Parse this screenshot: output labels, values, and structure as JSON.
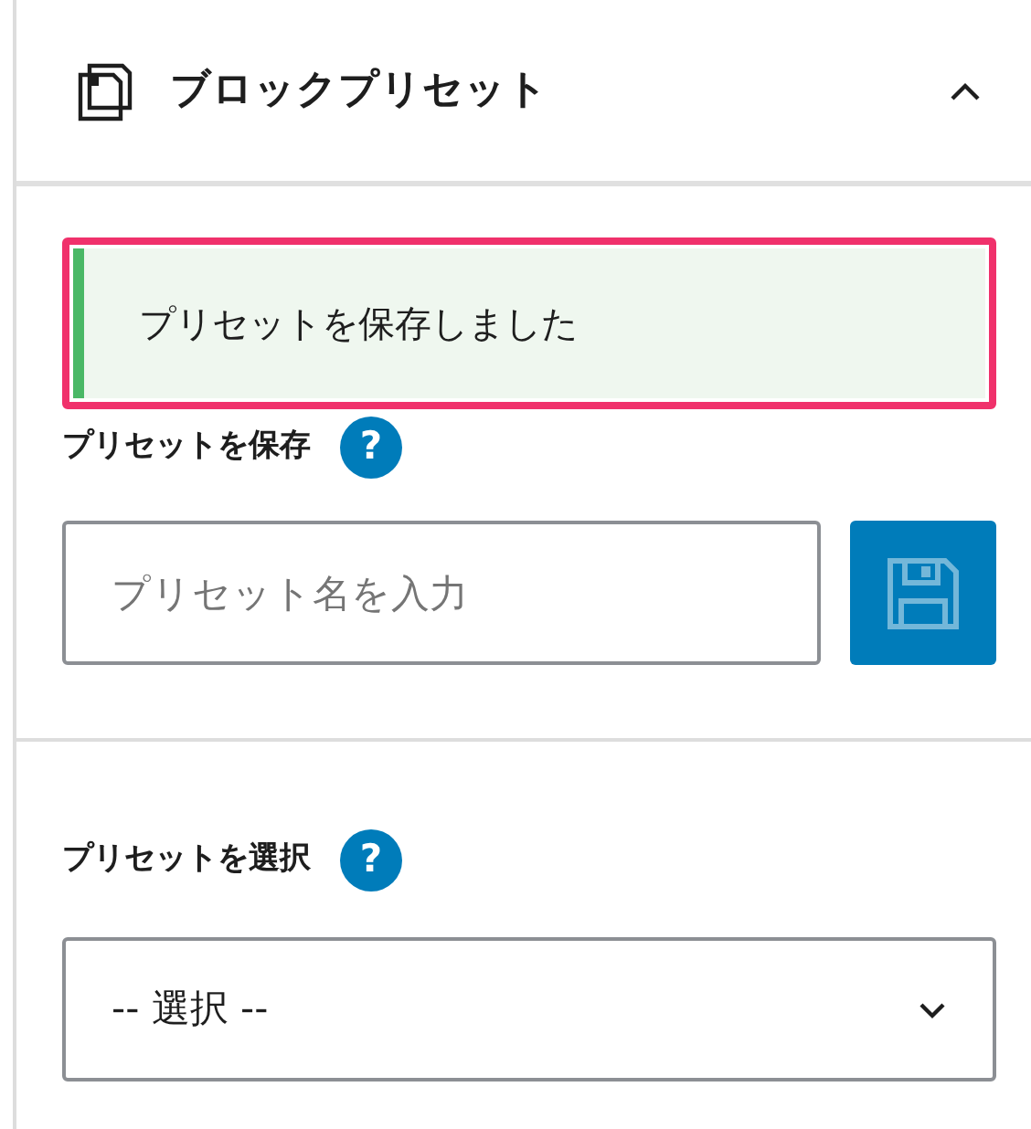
{
  "panel": {
    "title": "ブロックプリセット",
    "expanded": true
  },
  "notice": {
    "text": "プリセットを保存しました",
    "highlighted": true
  },
  "save_section": {
    "label": "プリセットを保存",
    "help": "?",
    "placeholder": "プリセット名を入力",
    "save_disabled": true
  },
  "select_section": {
    "label": "プリセットを選択",
    "help": "?",
    "value": "-- 選択 --"
  }
}
